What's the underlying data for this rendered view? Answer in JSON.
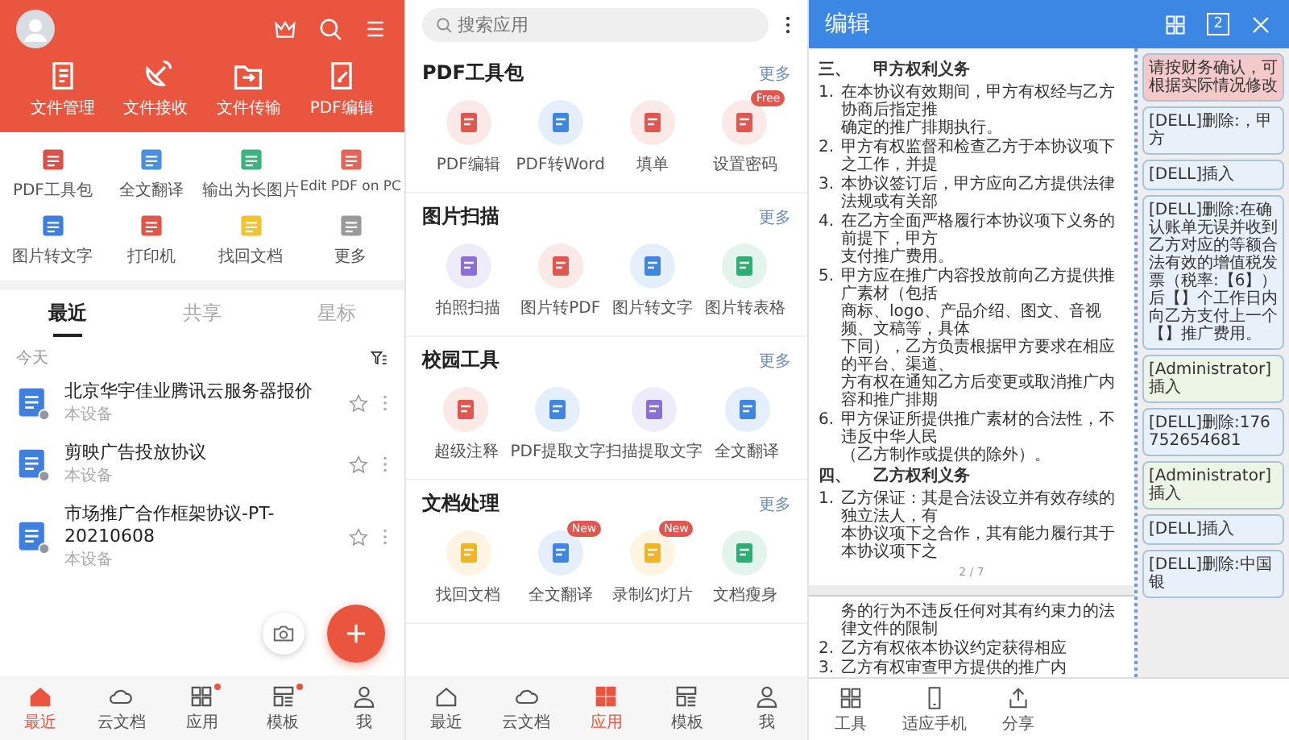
{
  "home_screen": {
    "quick_actions": [
      "文件管理",
      "文件接收",
      "文件传输",
      "PDF编辑"
    ],
    "tools": [
      {
        "label": "PDF工具包",
        "color": "#d9534a"
      },
      {
        "label": "全文翻译",
        "color": "#4a8fe0"
      },
      {
        "label": "输出为长图片",
        "color": "#3fb37f"
      },
      {
        "label": "Edit PDF on PC",
        "color": "#e0665a"
      },
      {
        "label": "图片转文字",
        "color": "#3d7fe0"
      },
      {
        "label": "打印机",
        "color": "#e0574a"
      },
      {
        "label": "找回文档",
        "color": "#f2c230"
      },
      {
        "label": "更多",
        "color": "#9a9a9a"
      }
    ],
    "tabs": [
      {
        "label": "最近",
        "selected": true
      },
      {
        "label": "共享",
        "selected": false
      },
      {
        "label": "星标",
        "selected": false
      }
    ],
    "group_label": "今天",
    "files": [
      {
        "name": "北京华宇佳业腾讯云服务器报价",
        "location": "本设备"
      },
      {
        "name": "剪映广告投放协议",
        "location": "本设备"
      },
      {
        "name": "市场推广合作框架协议-PT-20210608",
        "location": "本设备"
      }
    ],
    "nav": [
      {
        "label": "最近",
        "selected": true,
        "dot": false
      },
      {
        "label": "云文档",
        "selected": false,
        "dot": false
      },
      {
        "label": "应用",
        "selected": false,
        "dot": true
      },
      {
        "label": "模板",
        "selected": false,
        "dot": true
      },
      {
        "label": "我",
        "selected": false,
        "dot": false
      }
    ]
  },
  "apps_screen": {
    "search": {
      "placeholder": "搜索应用"
    },
    "sections": [
      {
        "title": "PDF工具包",
        "more": "更多",
        "items": [
          {
            "label": "PDF编辑",
            "color": "#e0574f"
          },
          {
            "label": "PDF转Word",
            "color": "#3f86e0"
          },
          {
            "label": "填单",
            "color": "#e0574f"
          },
          {
            "label": "设置密码",
            "color": "#e0574f",
            "badge": "Free"
          }
        ]
      },
      {
        "title": "图片扫描",
        "more": "更多",
        "items": [
          {
            "label": "拍照扫描",
            "color": "#8a6fd6"
          },
          {
            "label": "图片转PDF",
            "color": "#e0574f"
          },
          {
            "label": "图片转文字",
            "color": "#3f86e0"
          },
          {
            "label": "图片转表格",
            "color": "#2fae74"
          }
        ]
      },
      {
        "title": "校园工具",
        "more": "更多",
        "items": [
          {
            "label": "超级注释",
            "color": "#e0574f"
          },
          {
            "label": "PDF提取文字",
            "color": "#3f86e0"
          },
          {
            "label": "扫描提取文字",
            "color": "#8a6fd6"
          },
          {
            "label": "全文翻译",
            "color": "#3f86e0"
          }
        ]
      },
      {
        "title": "文档处理",
        "more": "更多",
        "items": [
          {
            "label": "找回文档",
            "color": "#f0b429"
          },
          {
            "label": "全文翻译",
            "color": "#3f86e0",
            "badge": "New"
          },
          {
            "label": "录制幻灯片",
            "color": "#f0b429",
            "badge": "New"
          },
          {
            "label": "文档瘦身",
            "color": "#2fae74"
          }
        ]
      }
    ],
    "nav": [
      {
        "label": "最近",
        "selected": false,
        "dot": false
      },
      {
        "label": "云文档",
        "selected": false,
        "dot": false
      },
      {
        "label": "应用",
        "selected": true,
        "dot": false
      },
      {
        "label": "模板",
        "selected": false,
        "dot": false
      },
      {
        "label": "我",
        "selected": false,
        "dot": false
      }
    ]
  },
  "editor_screen": {
    "title": "编辑",
    "page_number": "2",
    "document": [
      {
        "kind": "heading",
        "number": "三、",
        "text": "甲方权利义务"
      },
      {
        "kind": "item",
        "number": "1.",
        "lines": [
          "在本协议有效期间，甲方有权经与乙方协商后指定推",
          "确定的推广排期执行。"
        ]
      },
      {
        "kind": "item",
        "number": "2.",
        "lines": [
          "甲方有权监督和检查乙方于本协议项下之工作，并提"
        ]
      },
      {
        "kind": "item",
        "number": "3.",
        "lines": [
          "本协议签订后，甲方应向乙方提供法律法规或有关部"
        ]
      },
      {
        "kind": "item",
        "number": "4.",
        "lines": [
          "在乙方全面严格履行本协议项下义务的前提下，甲方",
          "支付推广费用。"
        ]
      },
      {
        "kind": "item",
        "number": "5.",
        "lines": [
          "甲方应在推广内容投放前向乙方提供推广素材（包括",
          "商标、logo、产品介绍、图文、音视频、文稿等，具体",
          "下同），乙方负责根据甲方要求在相应的平台、渠道、",
          "方有权在通知乙方后变更或取消推广内容和推广排期"
        ]
      },
      {
        "kind": "item",
        "number": "6.",
        "lines": [
          "甲方保证所提供推广素材的合法性，不违反中华人民",
          "（乙方制作或提供的除外）。"
        ]
      },
      {
        "kind": "heading",
        "number": "四、",
        "text": "乙方权利义务"
      },
      {
        "kind": "item",
        "number": "1.",
        "lines": [
          "乙方保证：其是合法设立并有效存续的独立法人，有",
          "本协议项下之合作，其有能力履行其于本协议项下之"
        ]
      },
      {
        "kind": "page_break",
        "text": "2 / 7"
      },
      {
        "kind": "item",
        "lines": [
          "务的行为不违反任何对其有约束力的法律文件的限制"
        ]
      },
      {
        "kind": "item",
        "number": "2.",
        "lines": [
          "乙方有权依本协议约定获得相应"
        ]
      },
      {
        "kind": "item",
        "number": "3.",
        "lines": [
          "乙方有权审查甲方提供的推广内"
        ]
      }
    ],
    "comments": [
      {
        "text": "请按财务确认，可根据实际情况修改",
        "color": "#f3c9c9"
      },
      {
        "text": "[DELL]删除:，甲方",
        "color": "#e8f0fa"
      },
      {
        "text": "[DELL]插入",
        "color": "#e8f0fa"
      },
      {
        "text": "[DELL]删除:在确认账单无误并收到乙方对应的等额合法有效的增值税发票（税率:【6】）后【】个工作日内向乙方支付上一个【】推广费用。",
        "color": "#e8f0fa"
      },
      {
        "text": "[Administrator]插入",
        "color": "#edf5e6"
      },
      {
        "text": "[DELL]删除:176752654681",
        "color": "#e8f0fa"
      },
      {
        "text": "[Administrator]插入",
        "color": "#edf5e6"
      },
      {
        "text": "[DELL]插入",
        "color": "#e8f0fa"
      },
      {
        "text": "[DELL]删除:中国银",
        "color": "#e8f0fa"
      }
    ],
    "toolbar": [
      {
        "label": "工具"
      },
      {
        "label": "适应手机"
      },
      {
        "label": "分享"
      }
    ]
  }
}
